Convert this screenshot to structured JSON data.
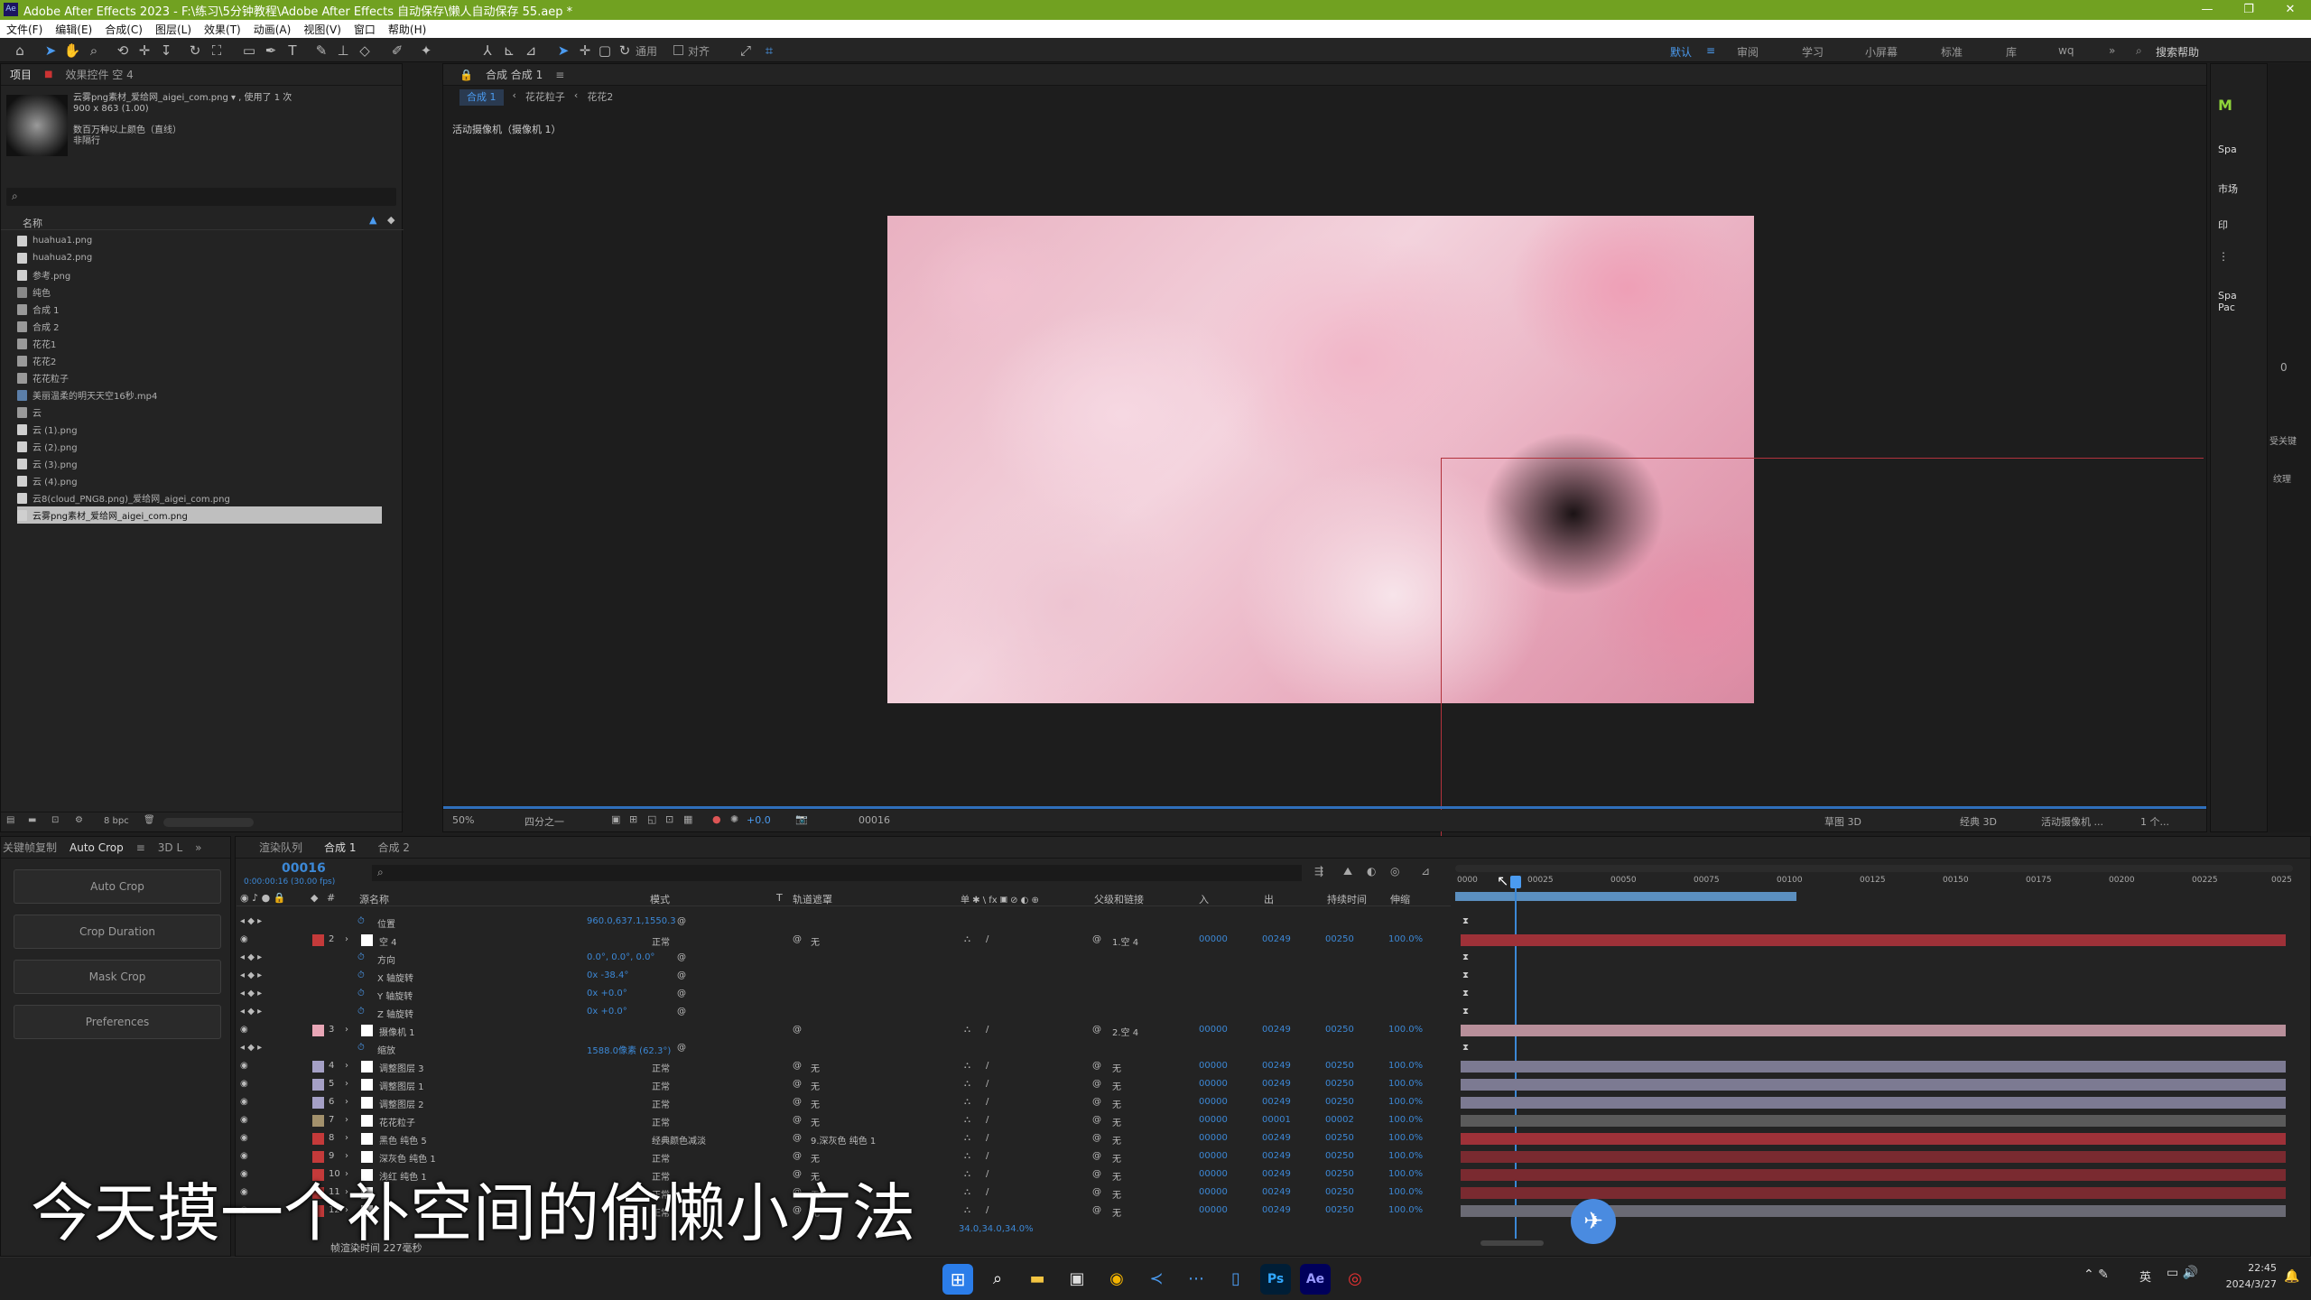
{
  "titlebar": {
    "title": "Adobe After Effects 2023 - F:\\练习\\5分钟教程\\Adobe After Effects 自动保存\\懒人自动保存 55.aep *",
    "controls": [
      "—",
      "❐",
      "✕"
    ]
  },
  "menu": [
    "文件(F)",
    "编辑(E)",
    "合成(C)",
    "图层(L)",
    "效果(T)",
    "动画(A)",
    "视图(V)",
    "窗口",
    "帮助(H)"
  ],
  "toolbar": {
    "snap_label": "对齐",
    "universal_label": "通用"
  },
  "workspaces": [
    "默认",
    "审阅",
    "学习",
    "小屏幕",
    "标准",
    "库",
    "wq"
  ],
  "search_help": "搜索帮助",
  "project_panel": {
    "tabs": [
      "项目",
      "效果控件 空 4"
    ],
    "preview": {
      "filename": "云雾png素材_爱给网_aigei_com.png ▾ , 使用了 1 次",
      "size": "900 x 863 (1.00)",
      "colors": "数百万种以上颜色（直线）",
      "interp": "非隔行"
    },
    "search_placeholder": "",
    "column_name": "名称",
    "items": [
      "huahua1.png",
      "huahua2.png",
      "参考.png",
      "纯色",
      "合成 1",
      "合成 2",
      "花花1",
      "花花2",
      "花花粒子",
      "美丽温柔的明天天空16秒.mp4",
      "云",
      "云 (1).png",
      "云 (2).png",
      "云 (3).png",
      "云 (4).png",
      "云8(cloud_PNG8.png)_爱给网_aigei_com.png",
      "云雾png素材_爱给网_aigei_com.png"
    ],
    "bpc": "8 bpc"
  },
  "comp_viewer": {
    "tab": "合成 合成 1",
    "breadcrumbs": [
      "合成 1",
      "花花粒子",
      "花花2"
    ],
    "camera_label": "活动摄像机（摄像机 1）",
    "zoom": "50%",
    "resolution": "四分之一",
    "exposure": "+0.0",
    "timecode": "00016",
    "renderer": "草图 3D",
    "classic3d": "经典 3D",
    "active_camera": "活动摄像机 ...",
    "views": "1 个..."
  },
  "right_panel": {
    "labels": [
      "Spa",
      "市场",
      "印",
      "Spa Pac",
      "0",
      "受关键",
      "纹理"
    ]
  },
  "autocrop": {
    "tabs": [
      "关键帧复制",
      "Auto Crop",
      "3D L"
    ],
    "buttons": [
      "Auto Crop",
      "Crop Duration",
      "Mask Crop",
      "Preferences"
    ]
  },
  "timeline": {
    "tabs": [
      "渲染队列",
      "合成 1",
      "合成 2"
    ],
    "timecode": "00016",
    "timecode_sub": "0:00:00:16 (30.00 fps)",
    "columns": [
      "源名称",
      "模式",
      "T",
      "轨道遮罩",
      "单 ✱ \\ fx 🞕 ⊘ ◐ ⊕",
      "父级和链接",
      "入",
      "出",
      "持续时间",
      "伸缩"
    ],
    "ruler": [
      "0000",
      "00025",
      "00050",
      "00075",
      "00100",
      "00125",
      "00150",
      "00175",
      "00200",
      "00225",
      "0025"
    ],
    "rows": [
      {
        "num": "",
        "name": "位置",
        "value": "960.0,637.1,1550.3",
        "kind": "prop"
      },
      {
        "num": "2",
        "name": "空 4",
        "color": "#c43a3a",
        "mode": "正常",
        "matte": "无",
        "parent": "1.空 4",
        "in": "00000",
        "out": "00249",
        "dur": "00250",
        "str": "100.0%",
        "kind": "layer",
        "bar": "#9e3138"
      },
      {
        "num": "",
        "name": "方向",
        "value": "0.0°, 0.0°, 0.0°",
        "kind": "prop"
      },
      {
        "num": "",
        "name": "X 轴旋转",
        "value": "0x -38.4°",
        "kind": "prop"
      },
      {
        "num": "",
        "name": "Y 轴旋转",
        "value": "0x +0.0°",
        "kind": "prop"
      },
      {
        "num": "",
        "name": "Z 轴旋转",
        "value": "0x +0.0°",
        "kind": "prop"
      },
      {
        "num": "3",
        "name": "摄像机 1",
        "color": "#e8a6b6",
        "mode": "",
        "matte": "",
        "parent": "2.空 4",
        "in": "00000",
        "out": "00249",
        "dur": "00250",
        "str": "100.0%",
        "kind": "layer",
        "bar": "#b88f9a"
      },
      {
        "num": "",
        "name": "缩放",
        "value": "1588.0像素 (62.3°)",
        "kind": "prop"
      },
      {
        "num": "4",
        "name": "调整图层 3",
        "color": "#a5a0c6",
        "mode": "正常",
        "matte": "无",
        "parent": "无",
        "in": "00000",
        "out": "00249",
        "dur": "00250",
        "str": "100.0%",
        "kind": "layer",
        "bar": "#7c7a92"
      },
      {
        "num": "5",
        "name": "调整图层 1",
        "color": "#a5a0c6",
        "mode": "正常",
        "matte": "无",
        "parent": "无",
        "in": "00000",
        "out": "00249",
        "dur": "00250",
        "str": "100.0%",
        "kind": "layer",
        "bar": "#7c7a92"
      },
      {
        "num": "6",
        "name": "调整图层 2",
        "color": "#a5a0c6",
        "mode": "正常",
        "matte": "无",
        "parent": "无",
        "in": "00000",
        "out": "00249",
        "dur": "00250",
        "str": "100.0%",
        "kind": "layer",
        "bar": "#7c7a92"
      },
      {
        "num": "7",
        "name": "花花粒子",
        "color": "#a3916c",
        "mode": "正常",
        "matte": "无",
        "parent": "无",
        "in": "00000",
        "out": "00001",
        "dur": "00002",
        "str": "100.0%",
        "kind": "layer",
        "bar": "#5a5a5a"
      },
      {
        "num": "8",
        "name": "黑色 纯色 5",
        "color": "#c43a3a",
        "mode": "经典颜色减淡",
        "matte": "9.深灰色 纯色 1",
        "parent": "无",
        "in": "00000",
        "out": "00249",
        "dur": "00250",
        "str": "100.0%",
        "kind": "layer",
        "bar": "#9e3138"
      },
      {
        "num": "9",
        "name": "深灰色 纯色 1",
        "color": "#c43a3a",
        "mode": "正常",
        "matte": "无",
        "parent": "无",
        "in": "00000",
        "out": "00249",
        "dur": "00250",
        "str": "100.0%",
        "kind": "layer",
        "bar": "#7a2a30"
      },
      {
        "num": "10",
        "name": "浅红 纯色 1",
        "color": "#c43a3a",
        "mode": "正常",
        "matte": "无",
        "parent": "无",
        "in": "00000",
        "out": "00249",
        "dur": "00250",
        "str": "100.0%",
        "kind": "layer",
        "bar": "#7a2a30"
      },
      {
        "num": "11",
        "name": "",
        "color": "#c43a3a",
        "mode": "正常",
        "matte": "无",
        "parent": "无",
        "in": "00000",
        "out": "00249",
        "dur": "00250",
        "str": "100.0%",
        "kind": "layer",
        "bar": "#7a2a30"
      },
      {
        "num": "12",
        "name": "",
        "color": "#c43a3a",
        "mode": "正常",
        "matte": "无",
        "parent": "无",
        "in": "00000",
        "out": "00249",
        "dur": "00250",
        "str": "100.0%",
        "kind": "layer",
        "bar": "#6a6a74"
      }
    ],
    "bottom_value": "34.0,34.0,34.0%",
    "render_time": "帧渲染时间 227毫秒"
  },
  "subtitle": "今天摸一个补空间的偷懒小方法",
  "taskbar": {
    "icons": [
      "windows-icon",
      "search-icon",
      "folder-icon",
      "store-icon",
      "chrome-icon",
      "vscode-icon",
      "app-icon",
      "phone-icon",
      "photoshop-icon",
      "aftereffects-icon",
      "record-icon"
    ],
    "labels": [
      "Ps",
      "Ae"
    ],
    "time": "22:45",
    "date": "2024/3/27",
    "lang": "英"
  },
  "colors": {
    "accent_green": "#71a121",
    "ae_blue": "#3c88d6"
  }
}
